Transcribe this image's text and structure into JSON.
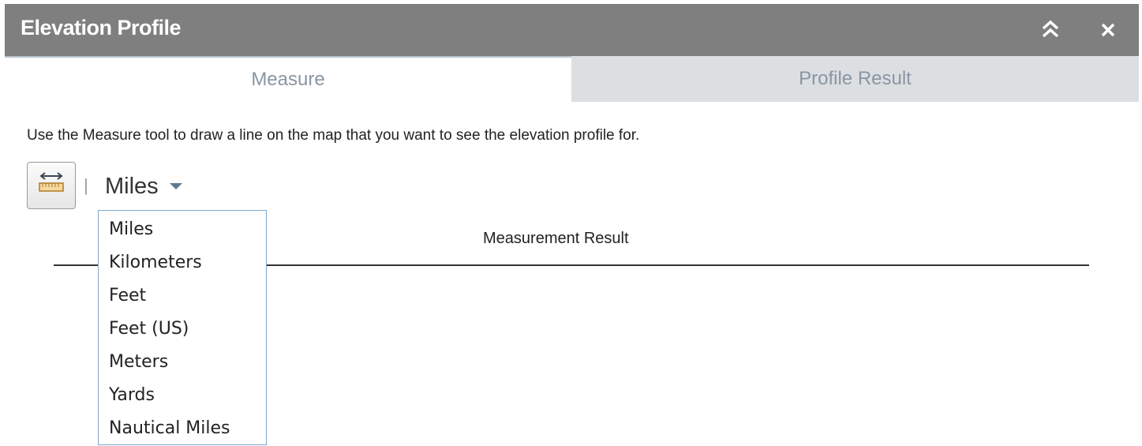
{
  "window": {
    "title": "Elevation Profile",
    "collapse_icon": "double-chevron-up-icon",
    "close_icon": "close-icon"
  },
  "tabs": [
    {
      "label": "Measure",
      "active": true
    },
    {
      "label": "Profile Result",
      "active": false
    }
  ],
  "instructions": "Use the Measure tool to draw a line on the map that you want to see the elevation profile for.",
  "measure_tool": {
    "icon": "ruler-measure-icon",
    "separator": "|"
  },
  "unit_select": {
    "selected": "Miles",
    "options": [
      "Miles",
      "Kilometers",
      "Feet",
      "Feet (US)",
      "Meters",
      "Yards",
      "Nautical Miles"
    ]
  },
  "result": {
    "label": "Measurement Result"
  },
  "colors": {
    "titlebar": "#7f7f7f",
    "tab_inactive": "#dcdfe2",
    "tab_text": "#8a96a3",
    "dropdown_border": "#7fa7c8",
    "arrow": "#5f7b91"
  }
}
